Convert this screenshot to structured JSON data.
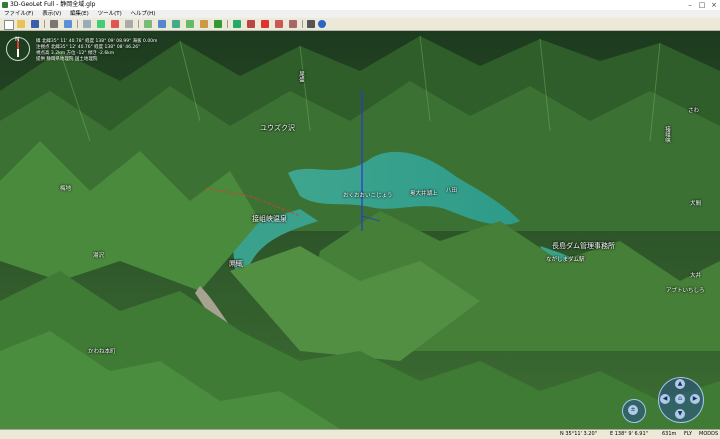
{
  "window": {
    "title": "3D-GeoLet Full - 静岡全域.glp"
  },
  "menu": [
    "ファイル(F)",
    "表示(V)",
    "編集(E)",
    "ツール(T)",
    "ヘルプ(H)"
  ],
  "hud": {
    "lines": [
      "緯  北緯35° 11' 40.78\"   経度 138° 09' 08.99\"   海抜 0.00m",
      "注視点  北緯35° 12' 40.76\"   経度 138° 08' 46.26\"",
      "視点高  3.2km  方位  -12°  傾き  -2.6km",
      "提供  静岡県地理院 国土地理院"
    ]
  },
  "places": [
    {
      "label": "ユウズク沢",
      "cls": ""
    },
    {
      "label": "梅地",
      "cls": "sm"
    },
    {
      "label": "湯沢",
      "cls": "sm"
    },
    {
      "label": "尾盛",
      "cls": "sm"
    },
    {
      "label": "閑蔵",
      "cls": ""
    },
    {
      "label": "接岨峡温泉",
      "cls": ""
    },
    {
      "label": "おくおおいこじょう",
      "cls": "sm"
    },
    {
      "label": "奥大井湖上",
      "cls": "sm"
    },
    {
      "label": "資料",
      "cls": "sm"
    },
    {
      "label": "八田",
      "cls": "sm"
    },
    {
      "label": "長島ダム管理事務所",
      "cls": ""
    },
    {
      "label": "ながしまダム駅",
      "cls": "sm"
    },
    {
      "label": "かわね本町",
      "cls": "sm"
    },
    {
      "label": "大井",
      "cls": "sm"
    },
    {
      "label": "接岨峡",
      "cls": "sm"
    },
    {
      "label": "さわ",
      "cls": "sm"
    },
    {
      "label": "アプトいちしろ",
      "cls": "sm"
    },
    {
      "label": "犬間",
      "cls": "sm"
    }
  ],
  "status": {
    "lat": "N 35°11' 3.20\"",
    "lon": "E 138° 9' 6.91\"",
    "alt": "631m",
    "mode": "FLY",
    "extra": "MODDS"
  },
  "nav": {
    "up": "▲",
    "down": "▼",
    "left": "◀",
    "right": "▶",
    "center": "⌂"
  }
}
